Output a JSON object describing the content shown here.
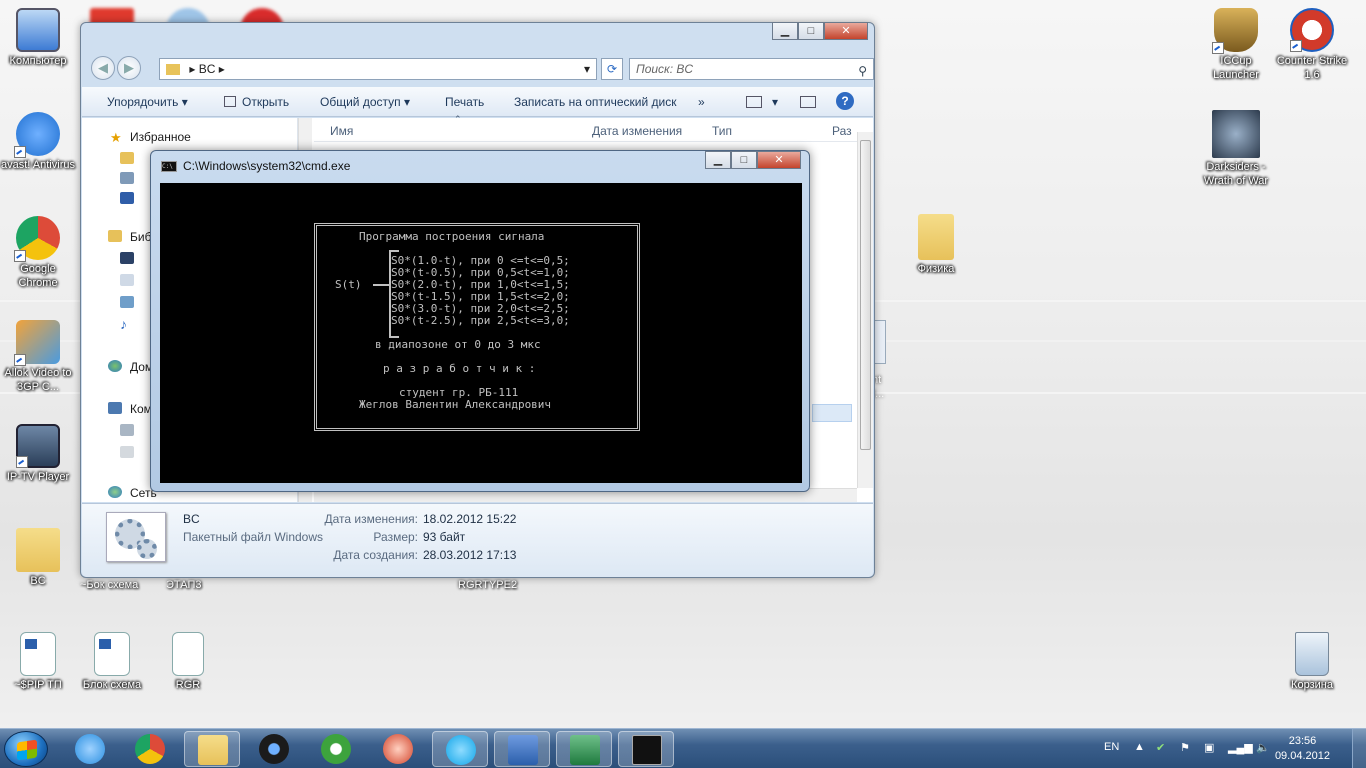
{
  "desktop": {
    "icons_left": [
      {
        "label": "Компьютер",
        "icon": "computer-icon",
        "color": "#3d7bd4"
      },
      {
        "label": "avast! Antivirus",
        "icon": "avast-icon",
        "color": "#1f6fd0"
      },
      {
        "label": "Google Chrome",
        "icon": "chrome-icon",
        "color": "#dd4b39"
      },
      {
        "label": "Allok Video to 3GP C...",
        "icon": "phone-converter-icon",
        "color": "#f2a33a"
      },
      {
        "label": "IP-TV Player",
        "icon": "tv-icon",
        "color": "#2b3f59"
      },
      {
        "label": "BC",
        "icon": "folder-icon",
        "color": "#e7c15a"
      }
    ],
    "icons_right": [
      {
        "label": "ICCup Launcher",
        "icon": "iccup-icon",
        "color": "#7a5a1e"
      },
      {
        "label": "Counter Strike 1.6",
        "icon": "counter-strike-icon",
        "color": "#d23a2a"
      },
      {
        "label": "Darksiders - Wrath of War",
        "icon": "darksiders-icon",
        "color": "#2c3a4c"
      },
      {
        "label": "Физика",
        "icon": "folder-icon",
        "color": "#e7c15a"
      }
    ],
    "bottom_icons": [
      {
        "label": "~$PIP TП",
        "icon": "word-doc-icon"
      },
      {
        "label": "Блок схема",
        "icon": "word-doc-icon"
      },
      {
        "label": "RGR",
        "icon": "text-file-icon"
      },
      {
        "label": "Корзина",
        "icon": "recycle-bin-icon"
      }
    ],
    "partial_labels": [
      "~Бок схема",
      "ЭТАП3",
      "RGRTYPE2"
    ]
  },
  "explorer": {
    "breadcrumb": [
      "BC"
    ],
    "search_placeholder": "Поиск: BC",
    "toolbar": {
      "organize": "Упорядочить",
      "open": "Открыть",
      "share": "Общий доступ",
      "print": "Печать",
      "burn": "Записать на оптический диск",
      "more": "»"
    },
    "nav": {
      "favorites": "Избранное",
      "libraries": "Библ",
      "homegroup": "Дом",
      "computer": "Комп",
      "network": "Сеть"
    },
    "columns": {
      "name": "Имя",
      "date": "Дата изменения",
      "type": "Тип",
      "size": "Раз"
    },
    "details": {
      "file_name": "BC",
      "file_type": "Пакетный файл Windows",
      "modified_label": "Дата изменения:",
      "modified_value": "18.02.2012 15:22",
      "size_label": "Размер:",
      "size_value": "93 байт",
      "created_label": "Дата создания:",
      "created_value": "28.03.2012 17:13"
    }
  },
  "cmd": {
    "title": "C:\\Windows\\system32\\cmd.exe",
    "heading": "Программа построения сигнала",
    "function_label": "S(t)",
    "rows": [
      "S0*(1.0-t), при 0 <=t<=0,5;",
      "S0*(t-0.5), при 0,5<t<=1,0;",
      "S0*(2.0-t), при 1,0<t<=1,5;",
      "S0*(t-1.5), при 1,5<t<=2,0;",
      "S0*(3.0-t), при 2,0<t<=2,5;",
      "S0*(t-2.5), при 2,5<t<=3,0;"
    ],
    "range": "в диапозоне от 0 до 3 мкс",
    "dev_label": "р а з р а б о т ч и к :",
    "student": "студент гр. РБ-111",
    "author": "Жеглов Валентин Александрович"
  },
  "taskbar": {
    "apps": [
      {
        "name": "internet-explorer-icon",
        "color": "#2a8fe0"
      },
      {
        "name": "chrome-icon",
        "color": "#dd4b39"
      },
      {
        "name": "explorer-folder-icon",
        "color": "#e7c15a"
      },
      {
        "name": "media-player-icon",
        "color": "#1b1b1b"
      },
      {
        "name": "utorrent-icon",
        "color": "#3da33d"
      },
      {
        "name": "ccleaner-icon",
        "color": "#d2432a"
      },
      {
        "name": "skype-icon",
        "color": "#11a5e8"
      },
      {
        "name": "word-icon",
        "color": "#2b5fab"
      },
      {
        "name": "excel-icon",
        "color": "#1f7a3e"
      },
      {
        "name": "cmd-icon",
        "color": "#111111"
      }
    ],
    "lang": "EN",
    "time": "23:56",
    "date": "09.04.2012"
  }
}
